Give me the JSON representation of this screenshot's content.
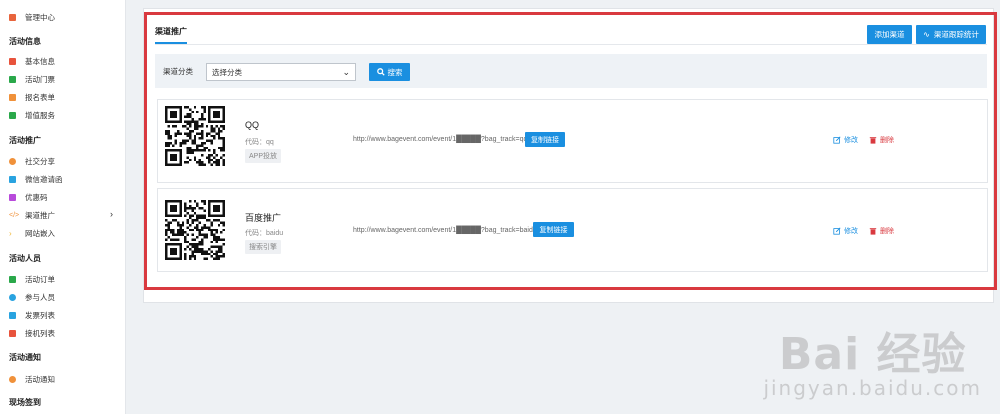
{
  "sidebar": {
    "top_item": {
      "label": "管理中心",
      "icon": "grid-icon",
      "color": "#e8643c"
    },
    "sections": [
      {
        "title": "活动信息"
      },
      {
        "title": "活动推广"
      },
      {
        "title": "活动人员"
      },
      {
        "title": "活动通知"
      },
      {
        "title": "现场签到"
      }
    ],
    "items": [
      {
        "label": "基本信息",
        "icon": "info-icon",
        "color": "#e8533c"
      },
      {
        "label": "活动门票",
        "icon": "ticket-icon",
        "color": "#2aa84a"
      },
      {
        "label": "报名表单",
        "icon": "form-icon",
        "color": "#f0913a"
      },
      {
        "label": "增值服务",
        "icon": "service-icon",
        "color": "#2aa84a"
      },
      {
        "label": "社交分享",
        "icon": "share-icon",
        "color": "#f0913a"
      },
      {
        "label": "微信邀请函",
        "icon": "wechat-icon",
        "color": "#29a3e0"
      },
      {
        "label": "优惠码",
        "icon": "coupon-icon",
        "color": "#b84adb"
      },
      {
        "label": "渠道推广",
        "icon": "code-icon",
        "color": "#f0913a"
      },
      {
        "label": "网站嵌入",
        "icon": "embed-icon",
        "color": "#f0b83a"
      },
      {
        "label": "活动订单",
        "icon": "order-icon",
        "color": "#2aa84a"
      },
      {
        "label": "参与人员",
        "icon": "people-icon",
        "color": "#29a3e0"
      },
      {
        "label": "发票列表",
        "icon": "invoice-icon",
        "color": "#29a3e0"
      },
      {
        "label": "接机列表",
        "icon": "pickup-icon",
        "color": "#e8533c"
      },
      {
        "label": "活动通知",
        "icon": "notify-icon",
        "color": "#f0913a"
      }
    ],
    "active_chevron": "›"
  },
  "main": {
    "tab_title": "渠道推广",
    "add_channel_button": "添加渠道",
    "stats_button": "渠道跟踪统计",
    "filter": {
      "label": "渠道分类",
      "select_value": "选择分类",
      "search_button": "搜索"
    },
    "channels": [
      {
        "name": "QQ",
        "code": "代码：qq",
        "tag": "APP投放",
        "url": "http://www.bagevent.com/event/1█████?bag_track=qq",
        "copy_label": "复制链接",
        "edit_label": "修改",
        "delete_label": "删除"
      },
      {
        "name": "百度推广",
        "code": "代码：baidu",
        "tag": "搜索引擎",
        "url": "http://www.bagevent.com/event/1█████?bag_track=baidu",
        "copy_label": "复制链接",
        "edit_label": "修改",
        "delete_label": "删除"
      }
    ]
  },
  "watermark": {
    "big": "Bai 经验",
    "small": "jingyan.baidu.com"
  },
  "colors": {
    "accent": "#1a8fe0",
    "highlight_frame": "#d9393f",
    "delete": "#d9393f"
  }
}
